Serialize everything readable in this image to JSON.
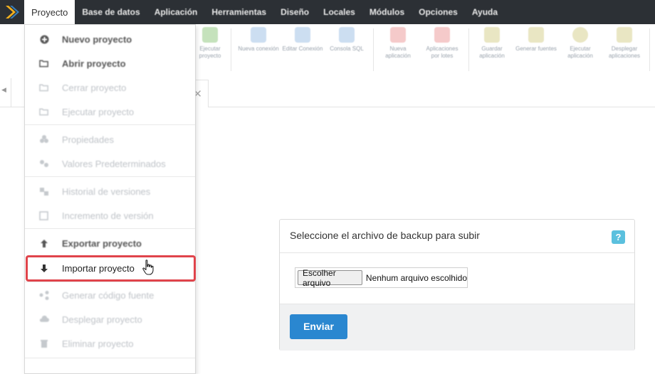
{
  "menubar": {
    "items": [
      {
        "label": "Proyecto"
      },
      {
        "label": "Base de datos"
      },
      {
        "label": "Aplicación"
      },
      {
        "label": "Herramientas"
      },
      {
        "label": "Diseño"
      },
      {
        "label": "Locales"
      },
      {
        "label": "Módulos"
      },
      {
        "label": "Opciones"
      },
      {
        "label": "Ayuda"
      }
    ]
  },
  "toolbar": {
    "buttons": [
      {
        "label": "Ejecutar proyecto",
        "icon": "run-project-icon"
      },
      {
        "label": "Nueva conexión",
        "icon": "new-connection-icon"
      },
      {
        "label": "Editar Conexión",
        "icon": "edit-connection-icon"
      },
      {
        "label": "Consola SQL",
        "icon": "sql-console-icon"
      },
      {
        "label": "Nueva aplicación",
        "icon": "new-app-icon"
      },
      {
        "label": "Aplicaciones por lotes",
        "icon": "batch-apps-icon"
      },
      {
        "label": "Guardar aplicación",
        "icon": "save-app-icon"
      },
      {
        "label": "Generar fuentes",
        "icon": "generate-sources-icon"
      },
      {
        "label": "Ejecutar aplicación",
        "icon": "run-app-icon"
      },
      {
        "label": "Desplegar aplicaciones",
        "icon": "deploy-apps-icon"
      }
    ]
  },
  "dropdown": {
    "items": [
      {
        "label": "Nuevo proyecto",
        "icon": "new-project-icon"
      },
      {
        "label": "Abrir proyecto",
        "icon": "open-folder-icon"
      },
      {
        "label": "Cerrar proyecto",
        "icon": "close-folder-icon"
      },
      {
        "label": "Ejecutar proyecto",
        "icon": "run-icon"
      },
      {
        "label": "Propiedades",
        "icon": "properties-icon"
      },
      {
        "label": "Valores Predeterminados",
        "icon": "defaults-icon"
      },
      {
        "label": "Historial de versiones",
        "icon": "history-icon"
      },
      {
        "label": "Incremento de versión",
        "icon": "version-icon"
      },
      {
        "label": "Exportar proyecto",
        "icon": "export-icon"
      },
      {
        "label": "Importar proyecto",
        "icon": "import-arrow-icon"
      },
      {
        "label": "Generar código fuente",
        "icon": "code-icon"
      },
      {
        "label": "Desplegar proyecto",
        "icon": "deploy-icon"
      },
      {
        "label": "Eliminar proyecto",
        "icon": "trash-icon"
      }
    ]
  },
  "upload": {
    "title": "Seleccione el archivo de backup para subir",
    "help": "?",
    "file_button": "Escolher arquivo",
    "file_status": "Nenhum arquivo escolhido",
    "submit": "Enviar"
  },
  "colors": {
    "menubar_bg": "#2c3035",
    "highlight": "#e0444b",
    "primary_button": "#2a87d0",
    "help_button": "#5bc0de"
  }
}
